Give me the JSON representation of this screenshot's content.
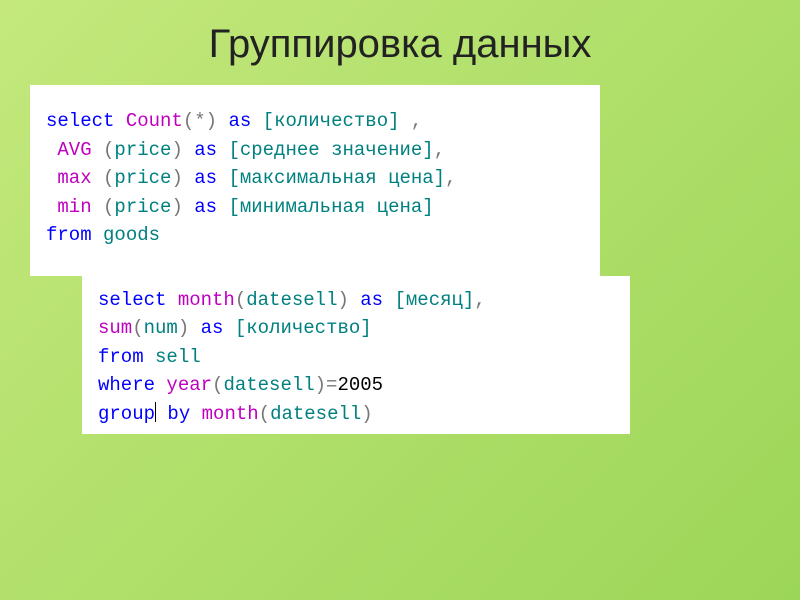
{
  "title": "Группировка данных",
  "code1": {
    "l1": {
      "a": "select",
      "b": " Count",
      "c": "(",
      "d": "*",
      "e": ")",
      "f": " as ",
      "g": "[количество] ",
      "h": ","
    },
    "l2": {
      "a": " AVG ",
      "b": "(",
      "c": "price",
      "d": ")",
      "e": " as ",
      "f": "[среднее значение]",
      "g": ","
    },
    "l3": {
      "a": " max ",
      "b": "(",
      "c": "price",
      "d": ")",
      "e": " as ",
      "f": "[максимальная цена]",
      "g": ","
    },
    "l4": {
      "a": " min ",
      "b": "(",
      "c": "price",
      "d": ")",
      "e": " as ",
      "f": "[минимальная цена]"
    },
    "l5": {
      "a": "from",
      "b": " goods"
    }
  },
  "code2": {
    "l1": {
      "a": "select",
      "b": " month",
      "c": "(",
      "d": "datesell",
      "e": ")",
      "f": " as ",
      "g": "[месяц]",
      "h": ","
    },
    "l2": {
      "a": "sum",
      "b": "(",
      "c": "num",
      "d": ")",
      "e": " as ",
      "f": "[количество]"
    },
    "l3": {
      "a": "from",
      "b": " sell"
    },
    "l4": {
      "a": "where",
      "b": " year",
      "c": "(",
      "d": "datesell",
      "e": ")=",
      "f": "2005"
    },
    "l5": {
      "a": "group",
      "b": " by",
      "c": " month",
      "d": "(",
      "e": "datesell",
      "f": ")"
    }
  }
}
